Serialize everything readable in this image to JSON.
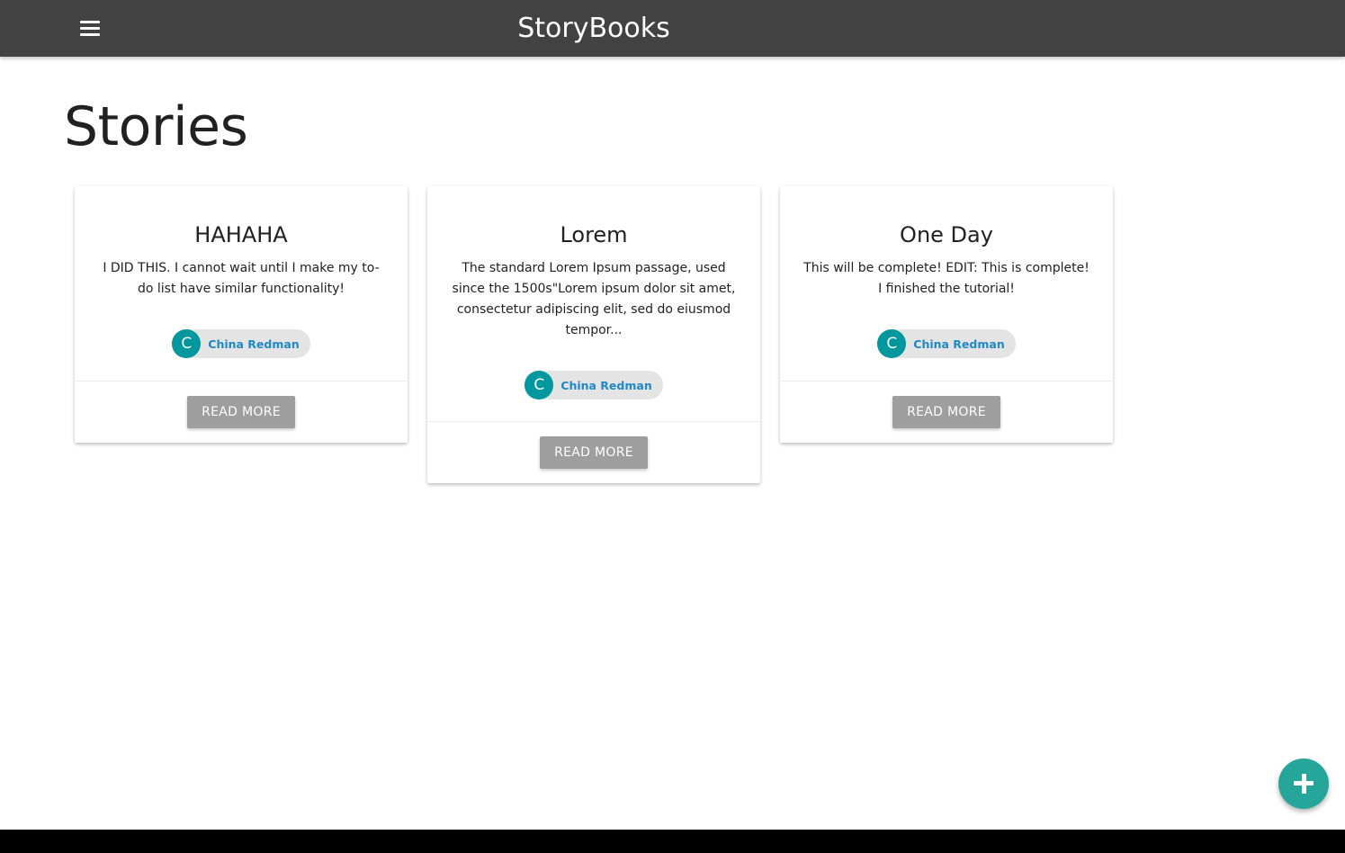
{
  "header": {
    "brand": "StoryBooks",
    "menu_icon": "hamburger-menu-icon",
    "background": "#424242"
  },
  "main": {
    "title": "Stories"
  },
  "stories": [
    {
      "title": "HAHAHA",
      "body": "I DID THIS. I cannot wait until I make my to-do list have similar functionality!",
      "author_initial": "C",
      "author": "China Redman",
      "button": "READ MORE"
    },
    {
      "title": "Lorem",
      "body": "The standard Lorem Ipsum passage, used since the 1500s\"Lorem ipsum dolor sit amet, consectetur adipiscing elit, sed do eiusmod tempor...",
      "author_initial": "C",
      "author": "China Redman",
      "button": "READ MORE"
    },
    {
      "title": "One Day",
      "body": "This will be complete! EDIT: This is complete! I finished the tutorial!",
      "author_initial": "C",
      "author": "China Redman",
      "button": "READ MORE"
    }
  ],
  "fab": {
    "icon": "plus-icon",
    "color": "#26a69a"
  },
  "colors": {
    "avatar": "#00979f",
    "author_link": "#1e88c8",
    "button": "#9e9e9e"
  }
}
